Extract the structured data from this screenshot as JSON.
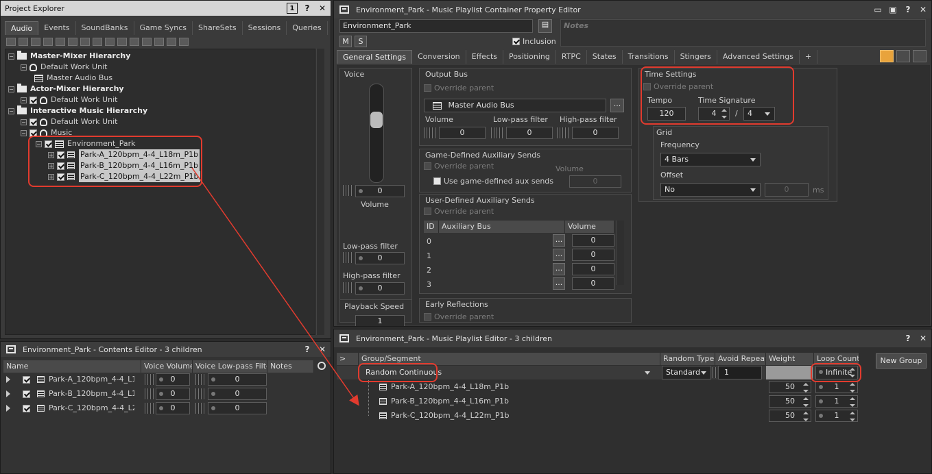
{
  "project_explorer": {
    "title": "Project Explorer",
    "tabs": [
      "Audio",
      "Events",
      "SoundBanks",
      "Game Syncs",
      "ShareSets",
      "Sessions",
      "Queries"
    ],
    "tree": {
      "master_mixer": "Master-Mixer Hierarchy",
      "default_work_unit_1": "Default Work Unit",
      "master_audio_bus": "Master Audio Bus",
      "actor_mixer": "Actor-Mixer Hierarchy",
      "default_work_unit_2": "Default Work Unit",
      "interactive_music": "Interactive Music Hierarchy",
      "default_work_unit_3": "Default Work Unit",
      "music": "Music",
      "environment_park": "Environment_Park",
      "segments": [
        "Park-A_120bpm_4-4_L18m_P1b",
        "Park-B_120bpm_4-4_L16m_P1b",
        "Park-C_120bpm_4-4_L22m_P1b"
      ]
    },
    "icons": [
      "info-icon",
      "help-icon",
      "close-icon"
    ]
  },
  "contents_editor": {
    "title": "Environment_Park - Contents Editor - 3 children",
    "columns": [
      "Name",
      "Voice Volume",
      "Voice Low-pass Filter",
      "Notes"
    ],
    "rows": [
      {
        "name": "Park-A_120bpm_4-4_L1...",
        "volume": "0",
        "lpf": "0"
      },
      {
        "name": "Park-B_120bpm_4-4_L1...",
        "volume": "0",
        "lpf": "0"
      },
      {
        "name": "Park-C_120bpm_4-4_L2...",
        "volume": "0",
        "lpf": "0"
      }
    ]
  },
  "property_editor": {
    "title": "Environment_Park - Music Playlist Container Property Editor",
    "name_value": "Environment_Park",
    "notes_placeholder": "Notes",
    "m_label": "M",
    "s_label": "S",
    "inclusion_label": "Inclusion",
    "tabs": [
      "General Settings",
      "Conversion",
      "Effects",
      "Positioning",
      "RTPC",
      "States",
      "Transitions",
      "Stingers",
      "Advanced Settings",
      "+"
    ],
    "voice": {
      "title": "Voice",
      "volume_value": "0",
      "volume_label": "Volume",
      "lpf_label": "Low-pass filter",
      "lpf_value": "0",
      "hpf_label": "High-pass filter",
      "hpf_value": "0",
      "playback_speed_label": "Playback Speed",
      "playback_speed_value": "1"
    },
    "output_bus": {
      "title": "Output Bus",
      "override_parent": "Override parent",
      "bus_name": "Master Audio Bus",
      "browse": "...",
      "volume_label": "Volume",
      "volume_value": "0",
      "lpf_label": "Low-pass filter",
      "lpf_value": "0",
      "hpf_label": "High-pass filter",
      "hpf_value": "0"
    },
    "game_aux": {
      "title": "Game-Defined Auxiliary Sends",
      "override_parent": "Override parent",
      "use_label": "Use game-defined aux sends",
      "volume_label": "Volume",
      "volume_value": "0"
    },
    "user_aux": {
      "title": "User-Defined Auxiliary Sends",
      "override_parent": "Override parent",
      "columns": [
        "ID",
        "Auxiliary Bus",
        "Volume"
      ],
      "rows": [
        {
          "id": "0",
          "volume": "0"
        },
        {
          "id": "1",
          "volume": "0"
        },
        {
          "id": "2",
          "volume": "0"
        },
        {
          "id": "3",
          "volume": "0"
        }
      ],
      "browse": "..."
    },
    "early_reflections": {
      "title": "Early Reflections",
      "override_parent": "Override parent"
    },
    "time_settings": {
      "title": "Time Settings",
      "override_parent": "Override parent",
      "tempo_label": "Tempo",
      "tempo_value": "120",
      "time_sig_label": "Time Signature",
      "time_sig_num": "4",
      "slash": "/",
      "time_sig_den": "4"
    },
    "grid": {
      "title": "Grid",
      "frequency_label": "Frequency",
      "frequency_value": "4 Bars",
      "offset_label": "Offset",
      "offset_value": "No",
      "offset_num": "0",
      "offset_unit": "ms"
    }
  },
  "playlist_editor": {
    "title": "Environment_Park - Music Playlist Editor - 3 children",
    "columns": [
      ">",
      "Group/Segment",
      "Random Type",
      "Avoid Repeat",
      "Weight",
      "Loop Count"
    ],
    "group": {
      "name": "Random Continuous",
      "random_type": "Standard",
      "avoid_repeat": "1",
      "loop_count": "Infinite"
    },
    "segments": [
      {
        "name": "Park-A_120bpm_4-4_L18m_P1b",
        "weight": "50",
        "loop": "1"
      },
      {
        "name": "Park-B_120bpm_4-4_L16m_P1b",
        "weight": "50",
        "loop": "1"
      },
      {
        "name": "Park-C_120bpm_4-4_L22m_P1b",
        "weight": "50",
        "loop": "1"
      }
    ],
    "new_group": "New Group"
  },
  "colors": {
    "highlight": "#e23b2e",
    "accent_orange": "#e8a33c"
  }
}
